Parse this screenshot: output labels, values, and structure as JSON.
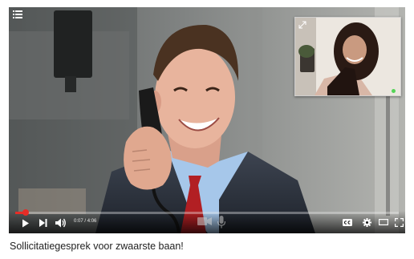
{
  "player": {
    "elapsed": "0:07",
    "duration": "4:06",
    "time_separator": " / ",
    "progress": 0.028
  },
  "video": {
    "title": "Sollicitatiegesprek voor zwaarste baan!"
  },
  "colors": {
    "progress": "#e52d27",
    "pip_status": "#55d457"
  }
}
